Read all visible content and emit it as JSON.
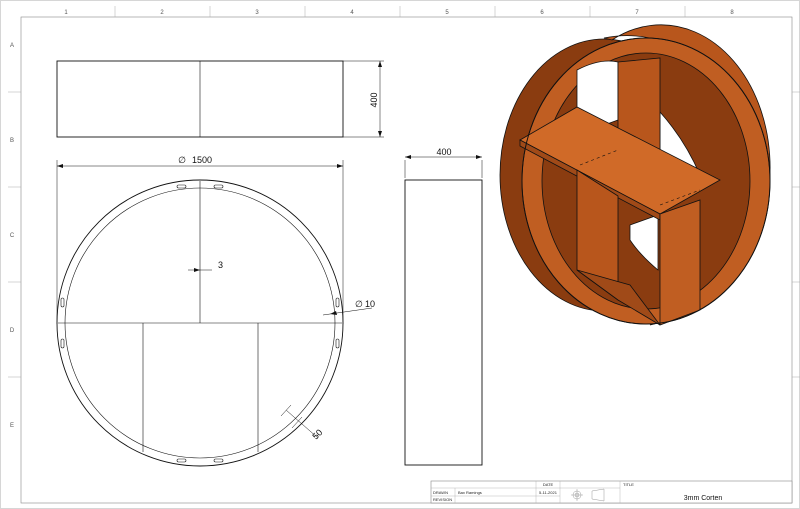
{
  "zones": {
    "columns": [
      "1",
      "2",
      "3",
      "4",
      "5",
      "6",
      "7",
      "8"
    ],
    "rows": [
      "A",
      "B",
      "C",
      "D",
      "E"
    ]
  },
  "dimensions": {
    "height": "400",
    "diameter_symbol": "∅",
    "diameter": "1500",
    "thickness": "3",
    "hole": "10",
    "slot": "50",
    "depth": "400"
  },
  "title_block": {
    "date_header": "DATE",
    "drawn_label": "DRAWN",
    "drawn_by": "Bax Ramings",
    "date": "5-11-2021",
    "revision_label": "REVISION",
    "title_header": "TITLE",
    "title": "3mm Corten"
  },
  "colors": {
    "corten_light": "#d06a28",
    "corten_mid": "#b8561c",
    "corten_dark": "#8a3c10",
    "line": "#111111"
  }
}
